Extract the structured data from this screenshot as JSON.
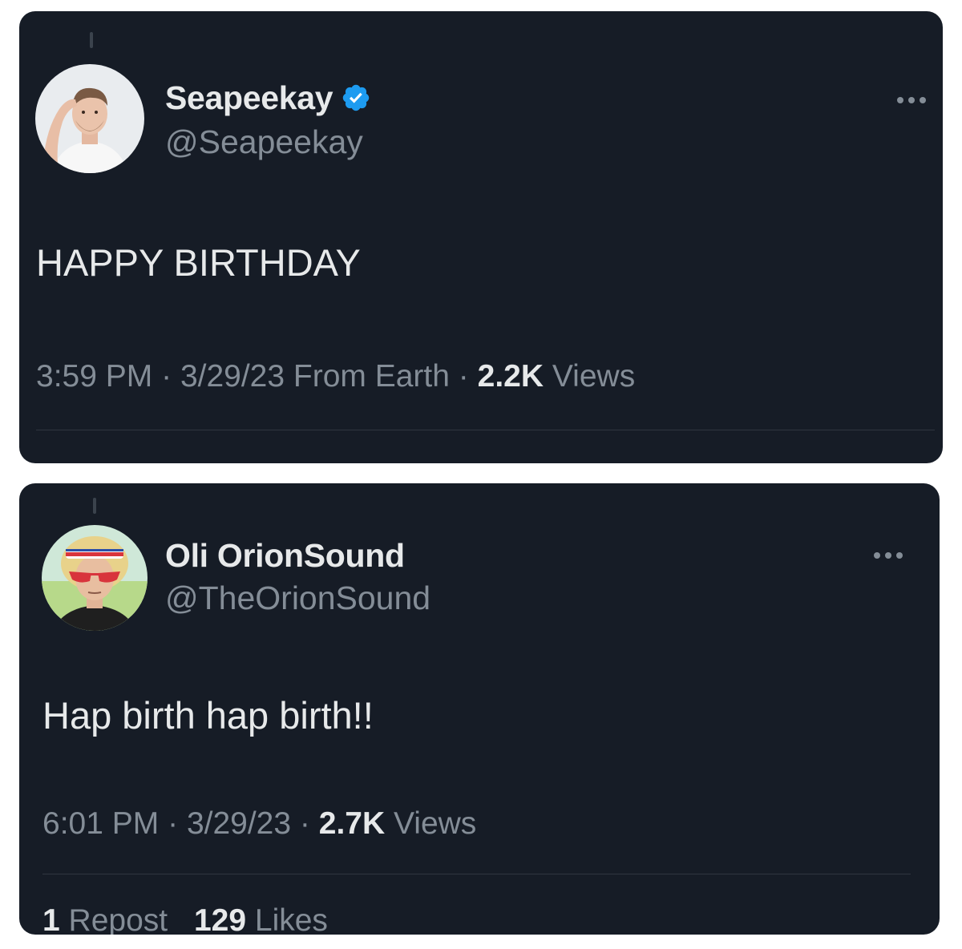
{
  "tweets": [
    {
      "display_name": "Seapeekay",
      "handle": "@Seapeekay",
      "verified": true,
      "text": "HAPPY BIRTHDAY",
      "time": "3:59 PM",
      "date": "3/29/23",
      "source": "From Earth",
      "views_count": "2.2K",
      "views_label": "Views",
      "separator": "·",
      "icons": {
        "verified": "verified-badge-icon",
        "more": "more-options-icon"
      }
    },
    {
      "display_name": "Oli OrionSound",
      "handle": "@TheOrionSound",
      "verified": false,
      "text": "Hap birth hap birth!!",
      "time": "6:01 PM",
      "date": "3/29/23",
      "views_count": "2.7K",
      "views_label": "Views",
      "separator": "·",
      "reposts_count": "1",
      "reposts_label": "Repost",
      "likes_count": "129",
      "likes_label": "Likes",
      "icons": {
        "more": "more-options-icon"
      }
    }
  ],
  "colors": {
    "card_background": "#161c26",
    "text_primary": "#e7e9ea",
    "text_secondary": "#848d97",
    "verified_blue": "#1d9bf0",
    "page_background": "#ffffff"
  }
}
